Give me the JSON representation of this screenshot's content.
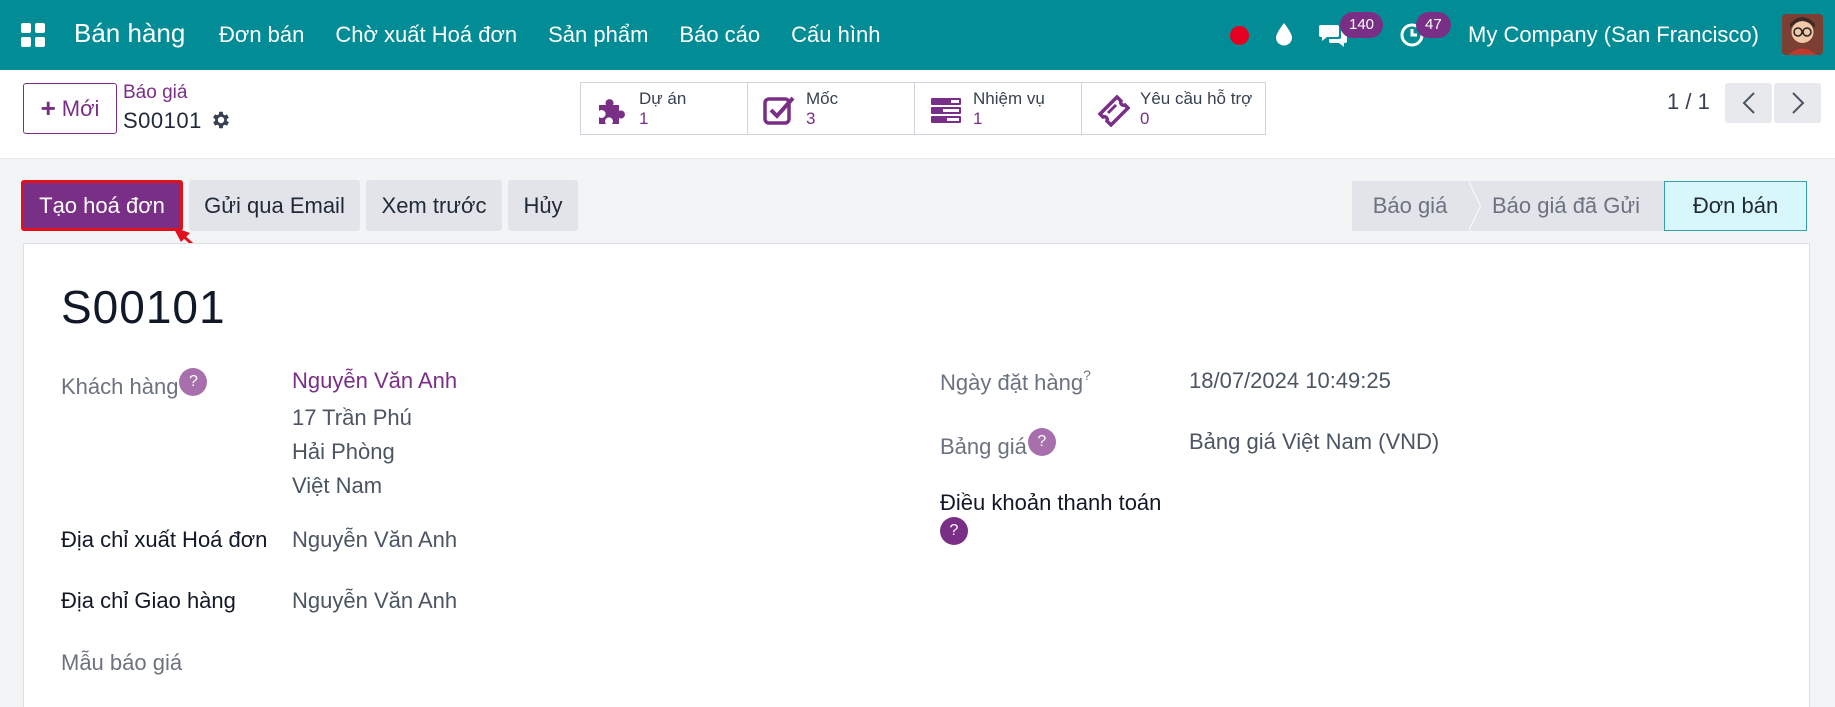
{
  "navbar": {
    "app_title": "Bán hàng",
    "menu": [
      "Đơn bán",
      "Chờ xuất Hoá đơn",
      "Sản phẩm",
      "Báo cáo",
      "Cấu hình"
    ],
    "messages_count": "140",
    "activities_count": "47",
    "company": "My Company (San Francisco)"
  },
  "control_panel": {
    "new_label": "Mới",
    "breadcrumb_parent": "Báo giá",
    "record_name": "S00101",
    "smart_buttons": [
      {
        "label": "Dự án",
        "value": "1",
        "icon": "puzzle-icon"
      },
      {
        "label": "Mốc",
        "value": "3",
        "icon": "check-square-icon"
      },
      {
        "label": "Nhiệm vụ",
        "value": "1",
        "icon": "tasks-icon"
      },
      {
        "label": "Yêu cầu hỗ trợ",
        "value": "0",
        "icon": "ticket-icon"
      }
    ],
    "pager": "1 / 1"
  },
  "actions": {
    "create_invoice": "Tạo hoá đơn",
    "send_email": "Gửi qua Email",
    "preview": "Xem trước",
    "cancel": "Hủy"
  },
  "statusbar": [
    "Báo giá",
    "Báo giá đã Gửi",
    "Đơn bán"
  ],
  "form": {
    "title": "S00101",
    "customer_label": "Khách hàng",
    "customer_name": "Nguyễn Văn Anh",
    "customer_address": [
      "17 Trần Phú",
      "Hải Phòng",
      "Việt Nam"
    ],
    "invoice_address_label": "Địa chỉ xuất Hoá đơn",
    "invoice_address_value": "Nguyễn Văn Anh",
    "delivery_address_label": "Địa chỉ Giao hàng",
    "delivery_address_value": "Nguyễn Văn Anh",
    "quote_template_label": "Mẫu báo giá",
    "order_date_label": "Ngày đặt hàng",
    "order_date_value": "18/07/2024 10:49:25",
    "pricelist_label": "Bảng giá",
    "pricelist_value": "Bảng giá Việt Nam (VND)",
    "payment_terms_label": "Điều khoản thanh toán",
    "help_mark": "?"
  },
  "colors": {
    "navbar": "#018c96",
    "primary": "#7a2f86",
    "annotation": "#e0111c"
  }
}
